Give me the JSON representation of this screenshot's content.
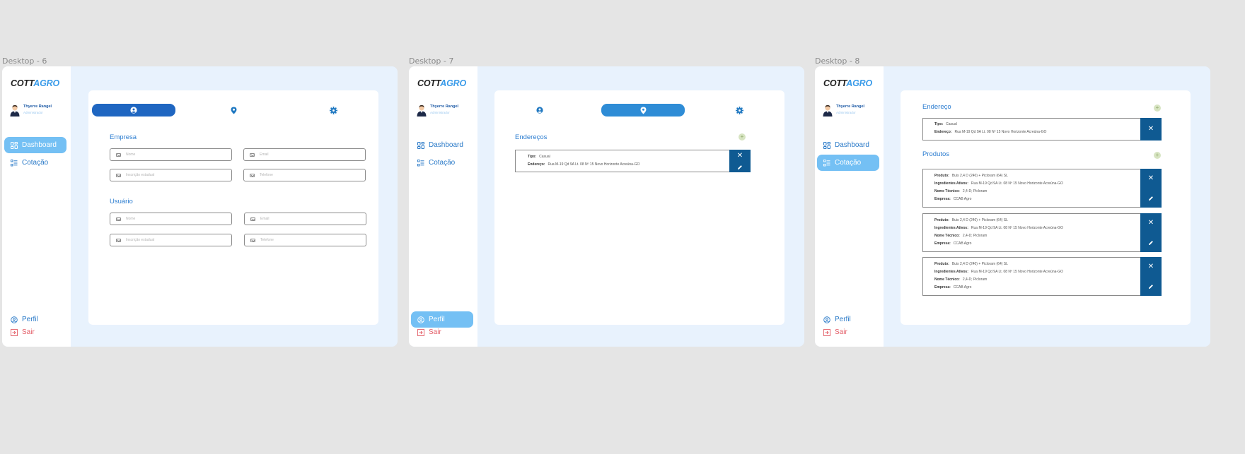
{
  "brand": {
    "part1": "COTT",
    "part2": "AGRO"
  },
  "user": {
    "name": "Thyerre Rangel",
    "role": "Administrador"
  },
  "nav": {
    "dashboard": "Dashboard",
    "cotacao": "Cotação",
    "perfil": "Perfil",
    "sair": "Sair"
  },
  "frames": [
    {
      "label": "Desktop - 6"
    },
    {
      "label": "Desktop - 7"
    },
    {
      "label": "Desktop - 8"
    }
  ],
  "desktop6": {
    "empresa_title": "Empresa",
    "usuario_title": "Usuário",
    "empresa_fields": [
      "Nome",
      "Email",
      "Inscrição estadual",
      "Telefone"
    ],
    "usuario_fields": [
      "Nome",
      "Email",
      "Inscrição estadual",
      "Telefone"
    ]
  },
  "desktop7": {
    "title": "Endereços",
    "address": {
      "tipo_label": "Tipo:",
      "tipo": "Casual",
      "endereco_label": "Endereço:",
      "endereco": "Rua M-19 Qd 9A Lt. 08 Nº 15 Novo Horizonte Acreúna-GO"
    }
  },
  "desktop8": {
    "endereco_title": "Endereço",
    "address": {
      "tipo_label": "Tipo:",
      "tipo": "Casual",
      "endereco_label": "Endereço:",
      "endereco": "Rua M-19 Qd 9A Lt. 08 Nº 15 Novo Horizonte Acreúna-GO"
    },
    "produtos_title": "Produtos",
    "produtos": [
      {
        "produto_label": "Produto:",
        "produto": "Buis 2,4 D (240) + Picloram (64) SL",
        "ingredientes_label": "Ingredientes Ativos:",
        "ingredientes": "Rua M-19 Qd 9A Lt. 08 Nº 15 Novo Horizonte Acreúna-GO",
        "tecnico_label": "Nome Técnico:",
        "tecnico": "2,4-D; Picloram",
        "empresa_label": "Empresa:",
        "empresa": "CCAB Agro"
      },
      {
        "produto_label": "Produto:",
        "produto": "Buis 2,4 D (240) + Picloram (64) SL",
        "ingredientes_label": "Ingredientes Ativos:",
        "ingredientes": "Rua M-19 Qd 9A Lt. 08 Nº 15 Novo Horizonte Acreúna-GO",
        "tecnico_label": "Nome Técnico:",
        "tecnico": "2,4-D; Picloram",
        "empresa_label": "Empresa:",
        "empresa": "CCAB Agro"
      },
      {
        "produto_label": "Produto:",
        "produto": "Buis 2,4 D (240) + Picloram (64) SL",
        "ingredientes_label": "Ingredientes Ativos:",
        "ingredientes": "Rua M-19 Qd 9A Lt. 08 Nº 15 Novo Horizonte Acreúna-GO",
        "tecnico_label": "Nome Técnico:",
        "tecnico": "2,4-D; Picloram",
        "empresa_label": "Empresa:",
        "empresa": "CCAB Agro"
      }
    ]
  },
  "colors": {
    "brand_dark": "#1f1f1f",
    "brand_blue": "#3a9be9",
    "active_nav": "#74c0f4",
    "tab_active": "#1f66c1",
    "action": "#0f5a92",
    "logout": "#e35d67",
    "frame_bg": "#e8f2fd"
  },
  "icons": {
    "user_tab": "user-circle-icon",
    "location_tab": "map-pin-icon",
    "settings_tab": "gear-icon",
    "dashboard": "grid-icon",
    "cotacao": "list-icon",
    "perfil": "user-circle-icon",
    "sair": "logout-icon",
    "field": "mail-icon",
    "add": "plus-icon",
    "close": "close-icon",
    "edit": "pencil-icon"
  }
}
